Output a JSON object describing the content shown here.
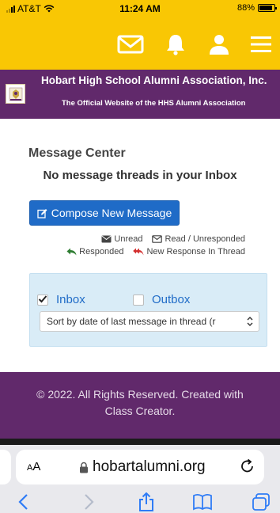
{
  "status_bar": {
    "carrier": "AT&T",
    "time": "11:24 AM",
    "battery": "88%",
    "battery_level": 0.88
  },
  "top_nav": {
    "icons": [
      "envelope-icon",
      "bell-icon",
      "user-icon",
      "hamburger-menu-icon"
    ]
  },
  "header": {
    "title": "Hobart High School Alumni Association, Inc.",
    "subtitle": "The Official Website of the HHS Alumni Association"
  },
  "message_center": {
    "title": "Message Center",
    "empty_message": "No message threads in your Inbox",
    "compose_label": "Compose New Message",
    "legend": {
      "unread": "Unread",
      "read_unresponded": "Read / Unresponded",
      "responded": "Responded",
      "new_response": "New Response In Thread"
    },
    "filters": {
      "inbox_label": "Inbox",
      "inbox_checked": true,
      "outbox_label": "Outbox",
      "outbox_checked": false,
      "sort_value": "Sort by date of last message in thread (r"
    }
  },
  "footer": {
    "line1": "© 2022. All Rights Reserved. Created with",
    "line2": "Class Creator."
  },
  "safari": {
    "text_size_label": "AA",
    "url": "hobartalumni.org"
  },
  "colors": {
    "nav_yellow": "#f9c704",
    "brand_purple": "#61296b",
    "button_blue": "#1f6bc7",
    "filter_bg": "#d9ecf7",
    "responded_green": "#2e7d32",
    "new_response_red": "#d32f2f",
    "safari_blue": "#2f7cf6"
  }
}
